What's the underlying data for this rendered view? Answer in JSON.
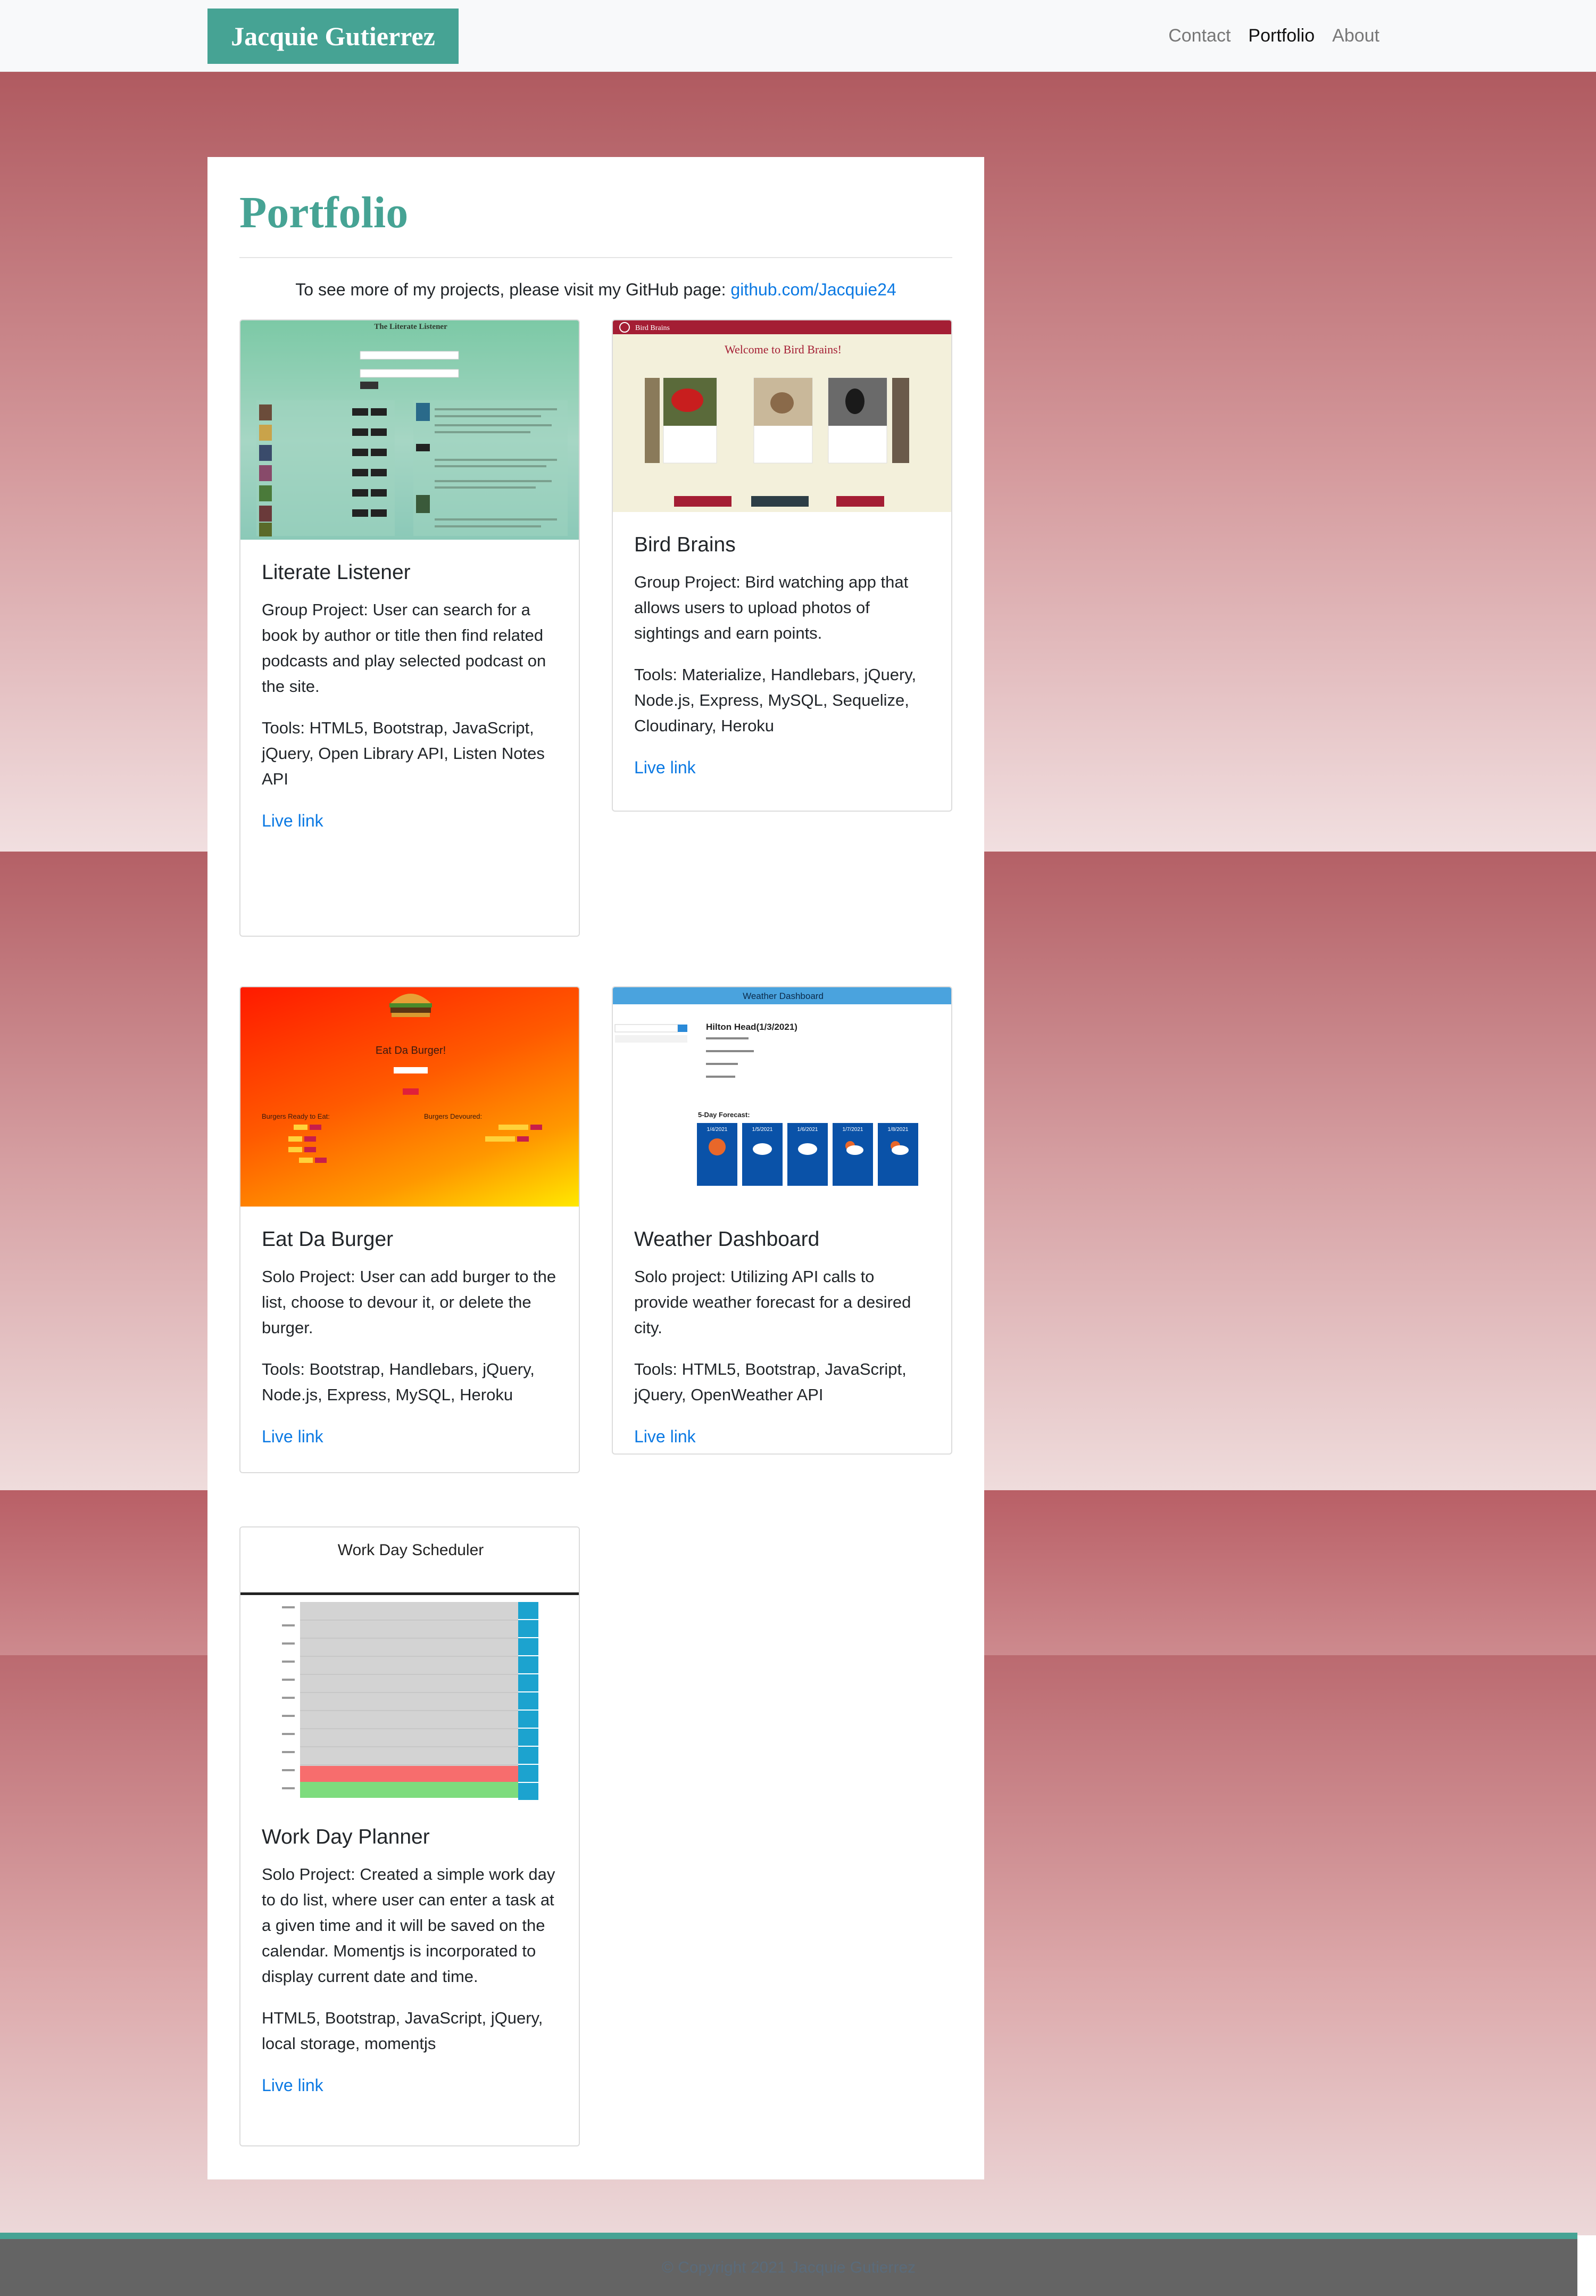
{
  "nav": {
    "brand": "Jacquie Gutierrez",
    "links": [
      {
        "label": "Contact",
        "active": false
      },
      {
        "label": "Portfolio",
        "active": true
      },
      {
        "label": "About",
        "active": false
      }
    ]
  },
  "page": {
    "title": "Portfolio",
    "intro_text": "To see more of my projects, please visit my GitHub page: ",
    "intro_link": "github.com/Jacquie24"
  },
  "projects": [
    {
      "title": "Literate Listener",
      "description": "Group Project: User can search for a book by author or title then find related podcasts and play selected podcast on the site.",
      "tools": "Tools: HTML5, Bootstrap, JavaScript, jQuery, Open Library API, Listen Notes API",
      "link": "Live link",
      "thumb_title": "The Literate Listener"
    },
    {
      "title": "Bird Brains",
      "description": "Group Project: Bird watching app that allows users to upload photos of sightings and earn points.",
      "tools": "Tools: Materialize, Handlebars, jQuery, Node.js, Express, MySQL, Sequelize, Cloudinary, Heroku",
      "link": "Live link",
      "thumb_header": "Bird Brains",
      "thumb_welcome": "Welcome to Bird Brains!"
    },
    {
      "title": "Eat Da Burger",
      "description": "Solo Project: User can add burger to the list, choose to devour it, or delete the burger.",
      "tools": "Tools: Bootstrap, Handlebars, jQuery, Node.js, Express, MySQL, Heroku",
      "link": "Live link",
      "thumb_title": "Eat Da Burger!",
      "thumb_ready": "Burgers Ready to Eat:",
      "thumb_devoured": "Burgers Devoured:"
    },
    {
      "title": "Weather Dashboard",
      "description": "Solo project: Utilizing API calls to provide weather forecast for a desired city.",
      "tools": "Tools: HTML5, Bootstrap, JavaScript, jQuery, OpenWeather API",
      "link": "Live link",
      "thumb_header": "Weather Dashboard",
      "thumb_city": "Hilton Head(1/3/2021)",
      "thumb_forecast": "5-Day Forecast:",
      "thumb_days": [
        "1/4/2021",
        "1/5/2021",
        "1/6/2021",
        "1/7/2021",
        "1/8/2021"
      ]
    },
    {
      "title": "Work Day Planner",
      "description": "Solo Project: Created a simple work day to do list, where user can enter a task at a given time and it will be saved on the calendar. Momentjs is incorporated to display current date and time.",
      "tools": "HTML5, Bootstrap, JavaScript, jQuery, local storage, momentjs",
      "link": "Live link",
      "thumb_title": "Work Day Scheduler"
    }
  ],
  "footer": {
    "text": "© Copyright 2021 Jacquie Gutierrez"
  },
  "colors": {
    "brand_teal": "#46a394",
    "link_blue": "#0b79e3",
    "footer_gray": "#646464"
  }
}
